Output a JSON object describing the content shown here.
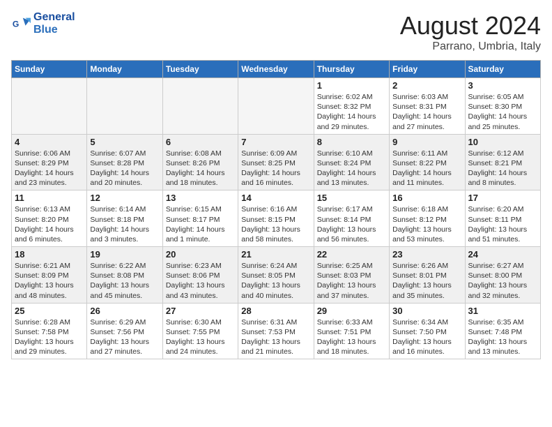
{
  "header": {
    "logo_line1": "General",
    "logo_line2": "Blue",
    "month_year": "August 2024",
    "location": "Parrano, Umbria, Italy"
  },
  "days_of_week": [
    "Sunday",
    "Monday",
    "Tuesday",
    "Wednesday",
    "Thursday",
    "Friday",
    "Saturday"
  ],
  "weeks": [
    [
      {
        "day": "",
        "info": ""
      },
      {
        "day": "",
        "info": ""
      },
      {
        "day": "",
        "info": ""
      },
      {
        "day": "",
        "info": ""
      },
      {
        "day": "1",
        "info": "Sunrise: 6:02 AM\nSunset: 8:32 PM\nDaylight: 14 hours\nand 29 minutes."
      },
      {
        "day": "2",
        "info": "Sunrise: 6:03 AM\nSunset: 8:31 PM\nDaylight: 14 hours\nand 27 minutes."
      },
      {
        "day": "3",
        "info": "Sunrise: 6:05 AM\nSunset: 8:30 PM\nDaylight: 14 hours\nand 25 minutes."
      }
    ],
    [
      {
        "day": "4",
        "info": "Sunrise: 6:06 AM\nSunset: 8:29 PM\nDaylight: 14 hours\nand 23 minutes."
      },
      {
        "day": "5",
        "info": "Sunrise: 6:07 AM\nSunset: 8:28 PM\nDaylight: 14 hours\nand 20 minutes."
      },
      {
        "day": "6",
        "info": "Sunrise: 6:08 AM\nSunset: 8:26 PM\nDaylight: 14 hours\nand 18 minutes."
      },
      {
        "day": "7",
        "info": "Sunrise: 6:09 AM\nSunset: 8:25 PM\nDaylight: 14 hours\nand 16 minutes."
      },
      {
        "day": "8",
        "info": "Sunrise: 6:10 AM\nSunset: 8:24 PM\nDaylight: 14 hours\nand 13 minutes."
      },
      {
        "day": "9",
        "info": "Sunrise: 6:11 AM\nSunset: 8:22 PM\nDaylight: 14 hours\nand 11 minutes."
      },
      {
        "day": "10",
        "info": "Sunrise: 6:12 AM\nSunset: 8:21 PM\nDaylight: 14 hours\nand 8 minutes."
      }
    ],
    [
      {
        "day": "11",
        "info": "Sunrise: 6:13 AM\nSunset: 8:20 PM\nDaylight: 14 hours\nand 6 minutes."
      },
      {
        "day": "12",
        "info": "Sunrise: 6:14 AM\nSunset: 8:18 PM\nDaylight: 14 hours\nand 3 minutes."
      },
      {
        "day": "13",
        "info": "Sunrise: 6:15 AM\nSunset: 8:17 PM\nDaylight: 14 hours\nand 1 minute."
      },
      {
        "day": "14",
        "info": "Sunrise: 6:16 AM\nSunset: 8:15 PM\nDaylight: 13 hours\nand 58 minutes."
      },
      {
        "day": "15",
        "info": "Sunrise: 6:17 AM\nSunset: 8:14 PM\nDaylight: 13 hours\nand 56 minutes."
      },
      {
        "day": "16",
        "info": "Sunrise: 6:18 AM\nSunset: 8:12 PM\nDaylight: 13 hours\nand 53 minutes."
      },
      {
        "day": "17",
        "info": "Sunrise: 6:20 AM\nSunset: 8:11 PM\nDaylight: 13 hours\nand 51 minutes."
      }
    ],
    [
      {
        "day": "18",
        "info": "Sunrise: 6:21 AM\nSunset: 8:09 PM\nDaylight: 13 hours\nand 48 minutes."
      },
      {
        "day": "19",
        "info": "Sunrise: 6:22 AM\nSunset: 8:08 PM\nDaylight: 13 hours\nand 45 minutes."
      },
      {
        "day": "20",
        "info": "Sunrise: 6:23 AM\nSunset: 8:06 PM\nDaylight: 13 hours\nand 43 minutes."
      },
      {
        "day": "21",
        "info": "Sunrise: 6:24 AM\nSunset: 8:05 PM\nDaylight: 13 hours\nand 40 minutes."
      },
      {
        "day": "22",
        "info": "Sunrise: 6:25 AM\nSunset: 8:03 PM\nDaylight: 13 hours\nand 37 minutes."
      },
      {
        "day": "23",
        "info": "Sunrise: 6:26 AM\nSunset: 8:01 PM\nDaylight: 13 hours\nand 35 minutes."
      },
      {
        "day": "24",
        "info": "Sunrise: 6:27 AM\nSunset: 8:00 PM\nDaylight: 13 hours\nand 32 minutes."
      }
    ],
    [
      {
        "day": "25",
        "info": "Sunrise: 6:28 AM\nSunset: 7:58 PM\nDaylight: 13 hours\nand 29 minutes."
      },
      {
        "day": "26",
        "info": "Sunrise: 6:29 AM\nSunset: 7:56 PM\nDaylight: 13 hours\nand 27 minutes."
      },
      {
        "day": "27",
        "info": "Sunrise: 6:30 AM\nSunset: 7:55 PM\nDaylight: 13 hours\nand 24 minutes."
      },
      {
        "day": "28",
        "info": "Sunrise: 6:31 AM\nSunset: 7:53 PM\nDaylight: 13 hours\nand 21 minutes."
      },
      {
        "day": "29",
        "info": "Sunrise: 6:33 AM\nSunset: 7:51 PM\nDaylight: 13 hours\nand 18 minutes."
      },
      {
        "day": "30",
        "info": "Sunrise: 6:34 AM\nSunset: 7:50 PM\nDaylight: 13 hours\nand 16 minutes."
      },
      {
        "day": "31",
        "info": "Sunrise: 6:35 AM\nSunset: 7:48 PM\nDaylight: 13 hours\nand 13 minutes."
      }
    ]
  ]
}
